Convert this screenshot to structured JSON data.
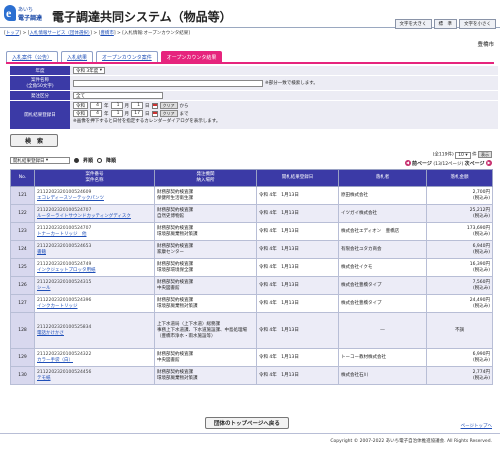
{
  "header": {
    "logo_top": "あいち",
    "logo_bottom": "電子調達",
    "title": "電子調達共同システム（物品等）",
    "font_buttons": [
      "文字を大きく",
      "標　準",
      "文字を小さく"
    ]
  },
  "breadcrumb": {
    "items": [
      "トップ",
      "入札情報サービス（団体選択）",
      "豊橋市",
      "入札情報:オープンカウンタ結果"
    ],
    "separator": " > "
  },
  "city": "豊橋市",
  "tabs": [
    "入札案件（公告）",
    "入札結果",
    "オープンカウンタ案件",
    "オープンカウンタ結果"
  ],
  "form": {
    "year_label": "年度",
    "year_value": "令和 3年度",
    "case_label": "案件名称",
    "case_note": "(全角50文字)",
    "case_hint": "※部分一致で検索します。",
    "type_label": "発注区分",
    "type_value": "全て",
    "date_label": "開札結果登録日",
    "era": "令和",
    "from_y": "4",
    "from_m": "1",
    "from_d": "1",
    "to_y": "4",
    "to_m": "1",
    "to_d": "17",
    "unit_y": "年",
    "unit_m": "月",
    "unit_d": "日",
    "clear": "クリア",
    "from_word": "から",
    "until_word": "まで",
    "cal_hint": "※画像を押下すると日付を指定するカレンダーダイアログを表示します。",
    "search_button": "検　索"
  },
  "sort": {
    "select_value": "開札結果登録日",
    "asc": "昇順",
    "desc": "降順"
  },
  "pager": {
    "total": "(全119件)",
    "per_page": "10",
    "per_unit": "件",
    "show": "表示",
    "prev": "前ページ",
    "page_info": "(13/12ページ)",
    "next": "次ページ"
  },
  "table": {
    "headers": {
      "no": "No.",
      "case_no": "案件番号",
      "case_name": "案件名称",
      "dept": "発注機関",
      "delivery": "納入場所",
      "date": "開札結果登録日",
      "bidder": "落札者",
      "amount": "落札金額"
    },
    "rows": [
      {
        "no": "121",
        "case_no": "2112202320100524609",
        "case_name": "エコレディースソーテックパンツ",
        "dept": "財務部契約検査課",
        "delivery": "保健所生活衛生課",
        "date": "令和 4年　1月13日",
        "bidder": "原田株式会社",
        "amount": "2,700円",
        "tax": "(税込み)"
      },
      {
        "no": "122",
        "case_no": "2112202320100524707",
        "case_name": "ルーターライトサウンドカッティングディスク",
        "dept": "財務部契約検査課",
        "delivery": "自然史博物館",
        "date": "令和 4年　1月13日",
        "bidder": "イツガイ株式会社",
        "amount": "25,212円",
        "tax": "(税込み)"
      },
      {
        "no": "123",
        "case_no": "2112202320100524707",
        "case_name": "トナーカートリッジ　他",
        "dept": "財務部契約検査課",
        "delivery": "環境部廃棄物対策課",
        "date": "令和 4年　1月13日",
        "bidder": "株式会社エディオン　豊橋店",
        "amount": "173,690円",
        "tax": "(税込み)"
      },
      {
        "no": "124",
        "case_no": "2112202320100524653",
        "case_name": "書籍",
        "dept": "財務部契約検査課",
        "delivery": "家康センター",
        "date": "令和 4年　1月13日",
        "bidder": "有限会社ユタカ商会",
        "amount": "6,940円",
        "tax": "(税込み)"
      },
      {
        "no": "125",
        "case_no": "2112202320100524749",
        "case_name": "インクジェットプロッタ用紙",
        "dept": "財務部契約検査課",
        "delivery": "環境部環境保全課",
        "date": "令和 4年　1月13日",
        "bidder": "株式会社イクモ",
        "amount": "16,390円",
        "tax": "(税込み)"
      },
      {
        "no": "126",
        "case_no": "2112202320100524315",
        "case_name": "シール",
        "dept": "財務部契約検査課",
        "delivery": "中央図書館",
        "date": "令和 4年　1月13日",
        "bidder": "株式会社豊橋タイプ",
        "amount": "7,560円",
        "tax": "(税込み)"
      },
      {
        "no": "127",
        "case_no": "2112202320100524396",
        "case_name": "インクカートリッジ",
        "dept": "財務部契約検査課",
        "delivery": "環境部廃棄物対策課",
        "date": "令和 4年　1月13日",
        "bidder": "株式会社豊橋タイプ",
        "amount": "24,490円",
        "tax": "(税込み)"
      },
      {
        "no": "128",
        "case_no": "2112202320100525834",
        "case_name": "電話かけかさ",
        "dept": "上下水道局（上下水道）総務課",
        "delivery": "事務上下水道課、下水道施設課、中島処理場（豊橋市浄水・雨水施設等）",
        "date": "令和 4年　1月13日",
        "bidder": "―",
        "amount": "不調",
        "tax": ""
      },
      {
        "no": "129",
        "case_no": "2112202320100524322",
        "case_name": "カラー手袋（白）",
        "dept": "財務部契約検査課",
        "delivery": "中央図書館",
        "date": "令和 4年　1月13日",
        "bidder": "トーコー教材株式会社",
        "amount": "6,990円",
        "tax": "(税込み)"
      },
      {
        "no": "130",
        "case_no": "2112202320100524456",
        "case_name": "テモ紙",
        "dept": "財務部契約検査課",
        "delivery": "環境部廃棄物対策課",
        "date": "令和 4年　1月13日",
        "bidder": "株式会社石川",
        "amount": "2,774円",
        "tax": "(税込み)"
      }
    ]
  },
  "back_button": "団体のトップページへ戻る",
  "page_top": "ページトップへ",
  "copyright": "Copyright © 2007-2022 あいち電子自治体推進協議会. All Rights Reserved."
}
